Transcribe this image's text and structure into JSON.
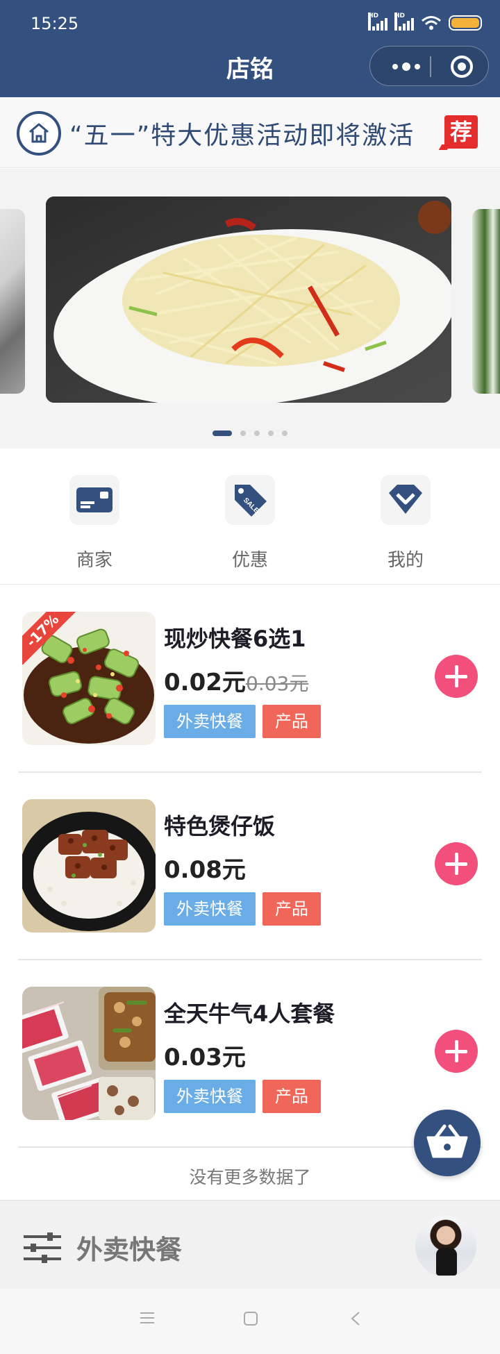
{
  "status_bar": {
    "time": "15:25",
    "signal_label_1": "HD",
    "signal_label_2": "HD"
  },
  "header": {
    "title": "店铭",
    "more_icon": "more-dots-icon",
    "close_icon": "target-circle-icon"
  },
  "notice": {
    "text": "“五一”特大优惠活动即将激活",
    "badge": "荐",
    "home_icon": "home-icon"
  },
  "carousel": {
    "slide_count": 5,
    "active_index": 0
  },
  "nav": [
    {
      "label": "商家",
      "icon": "card-icon"
    },
    {
      "label": "优惠",
      "icon": "sale-tag-icon"
    },
    {
      "label": "我的",
      "icon": "diamond-icon"
    }
  ],
  "products": [
    {
      "name": "现炒快餐6选1",
      "price": "0.02元",
      "old_price": "0.03元",
      "discount": "-17%",
      "tags": [
        "外卖快餐",
        "产品"
      ]
    },
    {
      "name": "特色煲仔饭",
      "price": "0.08元",
      "old_price": "",
      "discount": "",
      "tags": [
        "外卖快餐",
        "产品"
      ]
    },
    {
      "name": "全天牛气4人套餐",
      "price": "0.03元",
      "old_price": "",
      "discount": "",
      "tags": [
        "外卖快餐",
        "产品"
      ]
    }
  ],
  "list_footer": "没有更多数据了",
  "bottom_bar": {
    "label": "外卖快餐",
    "filter_icon": "filter-sliders-icon"
  },
  "colors": {
    "brand": "#33507e",
    "add": "#f24f7c",
    "tag_blue": "#6aade6",
    "tag_red": "#f0675a"
  }
}
